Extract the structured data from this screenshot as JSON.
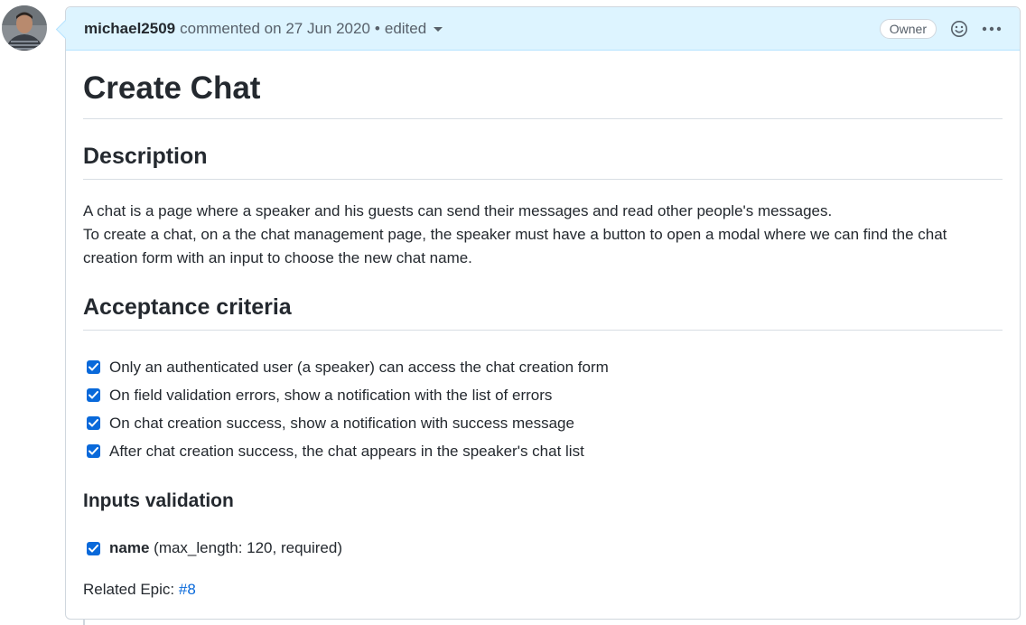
{
  "comment": {
    "author": "michael2509",
    "action": "commented on 27 Jun 2020",
    "separator": "•",
    "edited_label": "edited",
    "owner_badge": "Owner"
  },
  "icons": {
    "reaction": "smiley-icon",
    "more": "kebab-horizontal-icon",
    "checkbox": "check-icon"
  },
  "colors": {
    "accent": "#0969da",
    "header_bg": "#ddf4ff",
    "border": "#d0d7de",
    "text": "#24292f",
    "muted": "#57606a"
  },
  "body": {
    "title": "Create Chat",
    "description_heading": "Description",
    "description_line1": "A chat is a page where a speaker and his guests can send their messages and read other people's messages.",
    "description_line2": "To create a chat, on a the chat management page, the speaker must have a button to open a modal where we can find the chat creation form with an input to choose the new chat name.",
    "criteria_heading": "Acceptance criteria",
    "criteria": [
      "Only an authenticated user (a speaker) can access the chat creation form",
      "On field validation errors, show a notification with the list of errors",
      "On chat creation success, show a notification with success message",
      "After chat creation success, the chat appears in the speaker's chat list"
    ],
    "inputs_heading": "Inputs validation",
    "inputs": [
      {
        "name": "name",
        "rule": "(max_length: 120, required)"
      }
    ],
    "related_label": "Related Epic:",
    "related_link": "#8"
  }
}
